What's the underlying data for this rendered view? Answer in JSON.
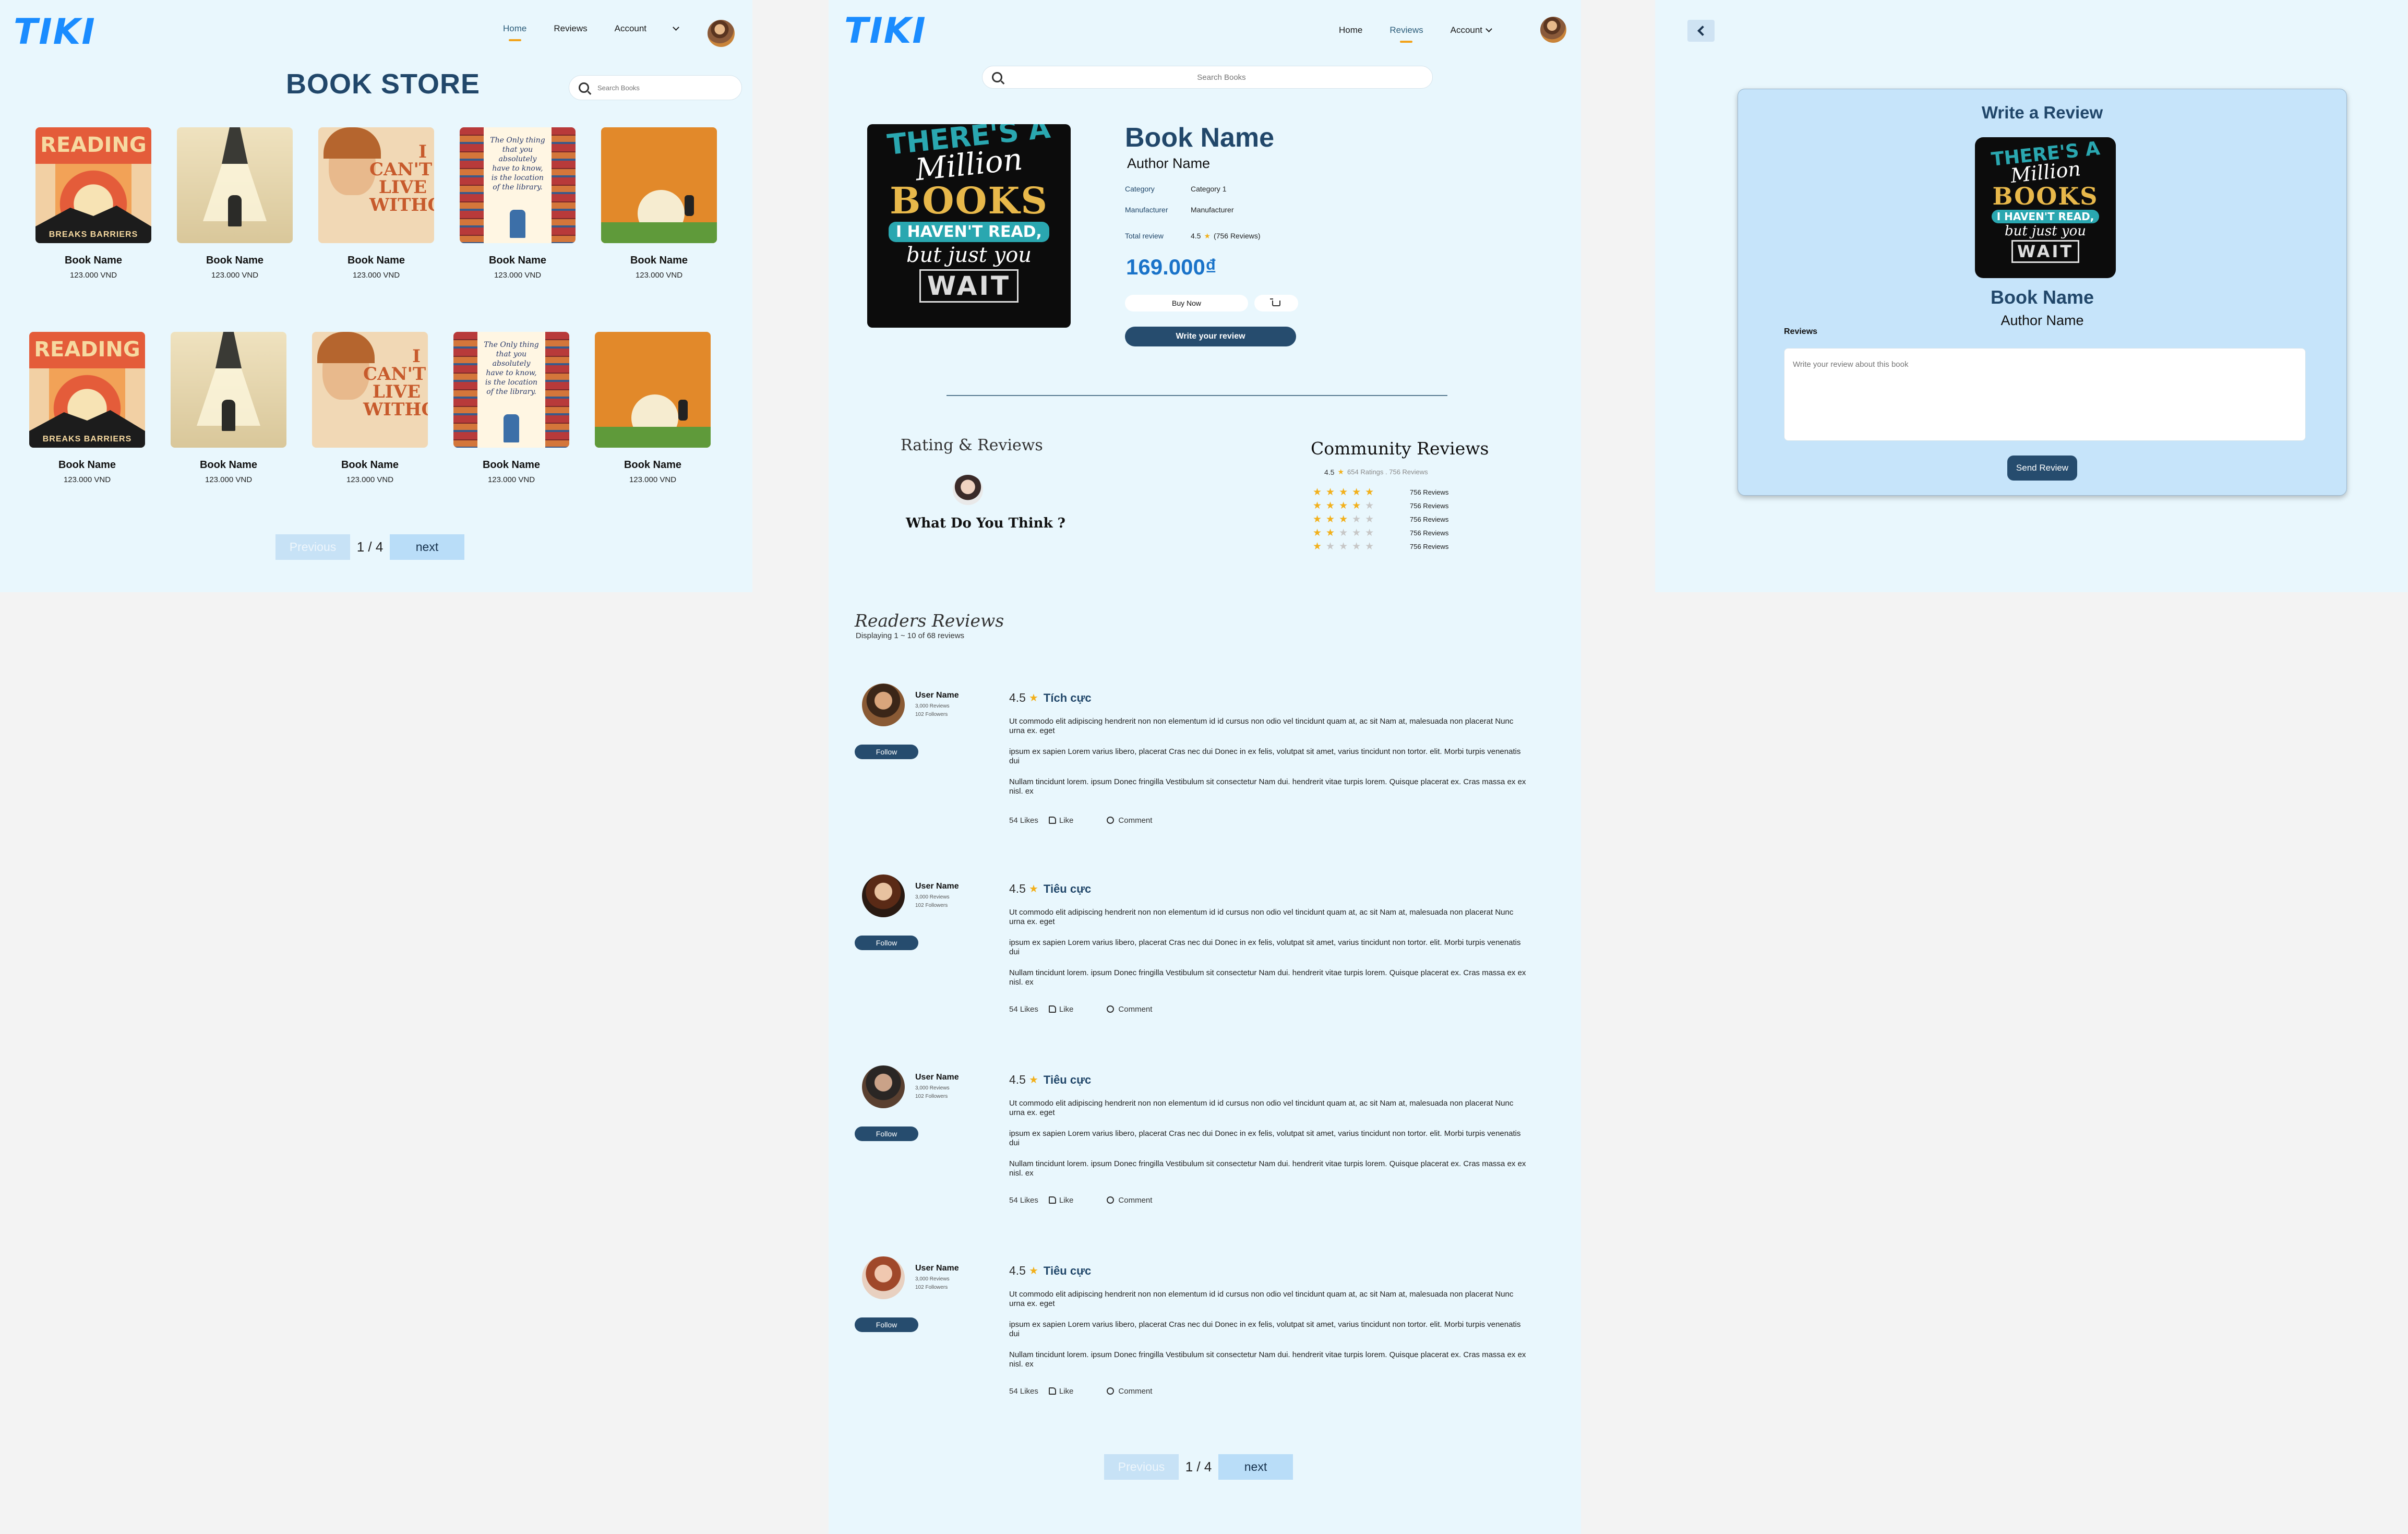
{
  "brand": {
    "logo": "TIKI",
    "accent": "#1a8cff"
  },
  "nav": {
    "home": "Home",
    "reviews": "Reviews",
    "account": "Account"
  },
  "store": {
    "title": "BOOK STORE",
    "search_placeholder": "Search Books",
    "books": [
      {
        "name": "Book Name",
        "price": "123.000 VND",
        "cover": "reading-breaks-barriers"
      },
      {
        "name": "Book Name",
        "price": "123.000 VND",
        "cover": "lamp-light"
      },
      {
        "name": "Book Name",
        "price": "123.000 VND",
        "cover": "i-cant-live-without"
      },
      {
        "name": "Book Name",
        "price": "123.000 VND",
        "cover": "library-shelves"
      },
      {
        "name": "Book Name",
        "price": "123.000 VND",
        "cover": "orange-moon"
      },
      {
        "name": "Book Name",
        "price": "123.000 VND",
        "cover": "reading-breaks-barriers"
      },
      {
        "name": "Book Name",
        "price": "123.000 VND",
        "cover": "lamp-light"
      },
      {
        "name": "Book Name",
        "price": "123.000 VND",
        "cover": "i-cant-live-without"
      },
      {
        "name": "Book Name",
        "price": "123.000 VND",
        "cover": "library-shelves"
      },
      {
        "name": "Book Name",
        "price": "123.000 VND",
        "cover": "orange-moon"
      }
    ],
    "cover_text": {
      "reading": "READING",
      "breaks": "BREAKS BARRIERS",
      "icant": "I CAN'T LIVE WITHOUT",
      "library": "The Only thing that you absolutely have to know, is the location of the library."
    },
    "pager": {
      "previous": "Previous",
      "current": "1 / 4",
      "next": "next"
    }
  },
  "detail": {
    "search_placeholder": "Search Books",
    "cover_lines": [
      "THERE'S A",
      "Million",
      "BOOKS",
      "I HAVEN'T READ,",
      "but just you",
      "WAIT"
    ],
    "title": "Book Name",
    "author": "Author Name",
    "category_label": "Category",
    "category_value": "Category 1",
    "manufacturer_label": "Manufacturer",
    "manufacturer_value": "Manufacturer",
    "total_review_label": "Total review",
    "total_review_score": "4.5",
    "total_review_count": "(756 Reviews)",
    "price": "169.000₫",
    "buy_now": "Buy Now",
    "write_review": "Write your review",
    "rating_reviews_title": "Rating & Reviews",
    "what_do_you_think": "What Do You Think ?",
    "community_title": "Community Reviews",
    "community_score": "4.5",
    "community_meta": "654 Ratings . 756 Reviews",
    "breakdown": [
      {
        "stars": 5,
        "label": "756 Reviews"
      },
      {
        "stars": 4,
        "label": "756 Reviews"
      },
      {
        "stars": 3,
        "label": "756 Reviews"
      },
      {
        "stars": 2,
        "label": "756 Reviews"
      },
      {
        "stars": 1,
        "label": "756 Reviews"
      }
    ],
    "readers_title": "Readers Reviews",
    "readers_sub": "Displaying 1 ~ 10 of 68 reviews",
    "reviews": [
      {
        "user": "User Name",
        "reviews": "3,000 Reviews",
        "followers": "102 Followers",
        "follow": "Follow",
        "score": "4.5",
        "tag": "Tích cực",
        "p1": "Ut commodo elit adipiscing hendrerit non non elementum id id cursus non odio vel tincidunt quam at, ac sit Nam at, malesuada non placerat Nunc urna ex. eget",
        "p2": "ipsum ex sapien Lorem varius libero, placerat Cras nec dui Donec in ex felis, volutpat sit amet, varius tincidunt non tortor. elit. Morbi turpis venenatis dui",
        "p3": "Nullam tincidunt lorem. ipsum Donec fringilla Vestibulum sit consectetur Nam dui. hendrerit vitae turpis lorem. Quisque placerat ex. Cras massa ex ex nisl. ex",
        "likes": "54 Likes",
        "like": "Like",
        "comment": "Comment"
      },
      {
        "user": "User Name",
        "reviews": "3,000 Reviews",
        "followers": "102 Followers",
        "follow": "Follow",
        "score": "4.5",
        "tag": "Tiêu cực",
        "p1": "Ut commodo elit adipiscing hendrerit non non elementum id id cursus non odio vel tincidunt quam at, ac sit Nam at, malesuada non placerat Nunc urna ex. eget",
        "p2": "ipsum ex sapien Lorem varius libero, placerat Cras nec dui Donec in ex felis, volutpat sit amet, varius tincidunt non tortor. elit. Morbi turpis venenatis dui",
        "p3": "Nullam tincidunt lorem. ipsum Donec fringilla Vestibulum sit consectetur Nam dui. hendrerit vitae turpis lorem. Quisque placerat ex. Cras massa ex ex nisl. ex",
        "likes": "54 Likes",
        "like": "Like",
        "comment": "Comment"
      },
      {
        "user": "User Name",
        "reviews": "3,000 Reviews",
        "followers": "102 Followers",
        "follow": "Follow",
        "score": "4.5",
        "tag": "Tiêu cực",
        "p1": "Ut commodo elit adipiscing hendrerit non non elementum id id cursus non odio vel tincidunt quam at, ac sit Nam at, malesuada non placerat Nunc urna ex. eget",
        "p2": "ipsum ex sapien Lorem varius libero, placerat Cras nec dui Donec in ex felis, volutpat sit amet, varius tincidunt non tortor. elit. Morbi turpis venenatis dui",
        "p3": "Nullam tincidunt lorem. ipsum Donec fringilla Vestibulum sit consectetur Nam dui. hendrerit vitae turpis lorem. Quisque placerat ex. Cras massa ex ex nisl. ex",
        "likes": "54 Likes",
        "like": "Like",
        "comment": "Comment"
      },
      {
        "user": "User Name",
        "reviews": "3,000 Reviews",
        "followers": "102 Followers",
        "follow": "Follow",
        "score": "4.5",
        "tag": "Tiêu cực",
        "p1": "Ut commodo elit adipiscing hendrerit non non elementum id id cursus non odio vel tincidunt quam at, ac sit Nam at, malesuada non placerat Nunc urna ex. eget",
        "p2": "ipsum ex sapien Lorem varius libero, placerat Cras nec dui Donec in ex felis, volutpat sit amet, varius tincidunt non tortor. elit. Morbi turpis venenatis dui",
        "p3": "Nullam tincidunt lorem. ipsum Donec fringilla Vestibulum sit consectetur Nam dui. hendrerit vitae turpis lorem. Quisque placerat ex. Cras massa ex ex nisl. ex",
        "likes": "54 Likes",
        "like": "Like",
        "comment": "Comment"
      }
    ],
    "pager": {
      "previous": "Previous",
      "current": "1 / 4",
      "next": "next"
    }
  },
  "write": {
    "title": "Write a Review",
    "book_name": "Book Name",
    "author": "Author Name",
    "reviews_label": "Reviews",
    "placeholder": "Write your review about this book",
    "send": "Send Review"
  }
}
